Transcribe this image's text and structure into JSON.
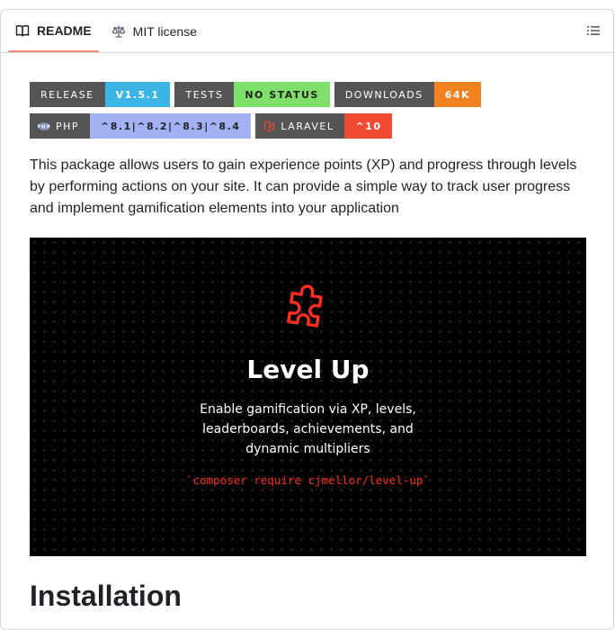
{
  "tabs": [
    {
      "label": "README",
      "icon": "book-icon",
      "active": true
    },
    {
      "label": "MIT license",
      "icon": "scale-icon",
      "active": false
    }
  ],
  "toc_icon": "list-icon",
  "badges": {
    "row1": [
      {
        "label": "RELEASE",
        "value": "V1.5.1",
        "color": "#3ab5e6"
      },
      {
        "label": "TESTS",
        "value": "NO STATUS",
        "color": "#7ee06a"
      },
      {
        "label": "DOWNLOADS",
        "value": "64K",
        "color": "#f58220"
      }
    ],
    "row2": [
      {
        "label": "PHP",
        "value": "^8.1|^8.2|^8.3|^8.4",
        "color": "#a3b1f5",
        "icon": "php-icon"
      },
      {
        "label": "LARAVEL",
        "value": "^10",
        "color": "#f04a32",
        "icon": "laravel-icon"
      }
    ]
  },
  "description": "This package allows users to gain experience points (XP) and progress through levels by performing actions on your site. It can provide a simple way to track user progress and implement gamification elements into your application",
  "banner": {
    "icon": "puzzle-icon",
    "title": "Level Up",
    "tagline_1": "Enable gamification via XP, levels,",
    "tagline_2": "leaderboards, achievements, and",
    "tagline_3": "dynamic multipliers",
    "command": "`composer require cjmellor/level-up`",
    "accent": "#ff2d20"
  },
  "section_heading": "Installation"
}
